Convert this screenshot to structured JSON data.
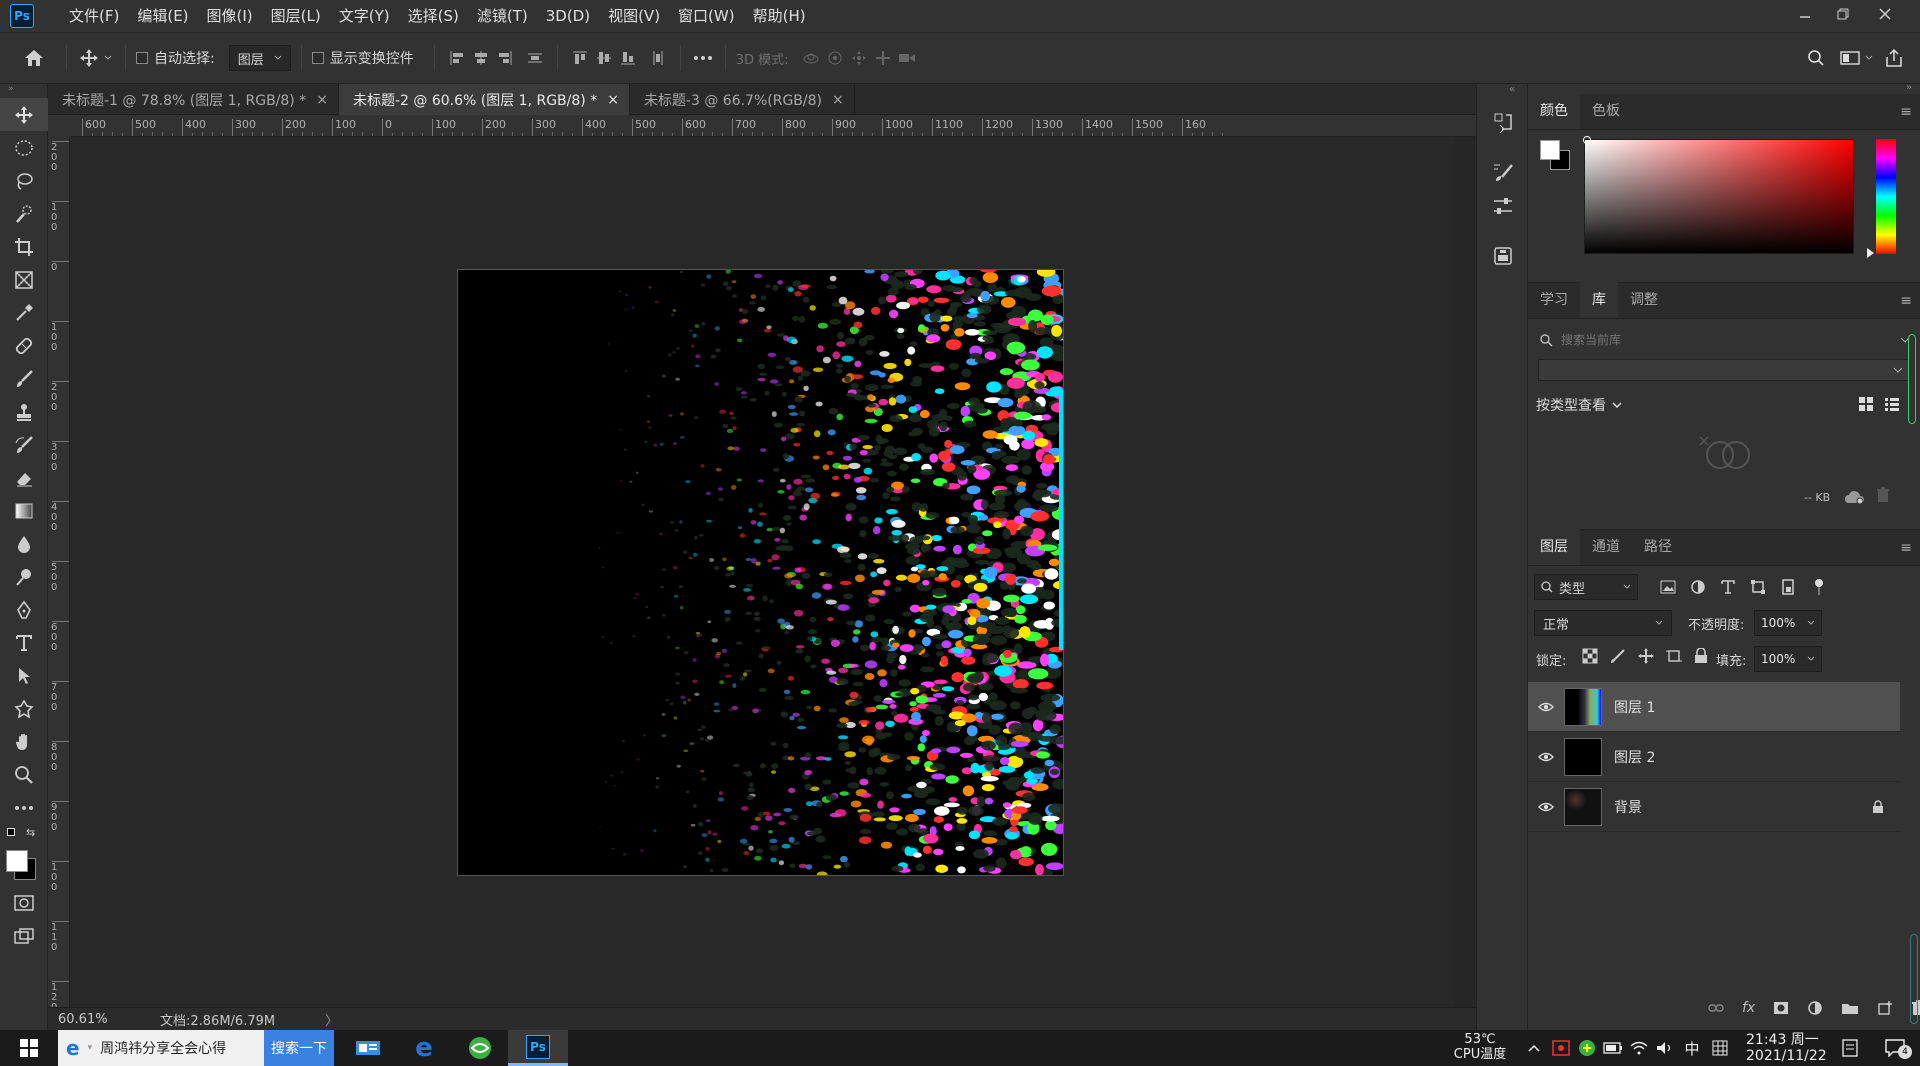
{
  "app": {
    "logo": "Ps"
  },
  "menu": {
    "items": [
      "文件(F)",
      "编辑(E)",
      "图像(I)",
      "图层(L)",
      "文字(Y)",
      "选择(S)",
      "滤镜(T)",
      "3D(D)",
      "视图(V)",
      "窗口(W)",
      "帮助(H)"
    ]
  },
  "options": {
    "auto_select_label": "自动选择:",
    "auto_select_target": "图层",
    "show_transform_label": "显示变换控件",
    "mode3d_label": "3D 模式:"
  },
  "tabs": [
    {
      "label": "未标题-1 @ 78.8% (图层 1, RGB/8) *",
      "close": "×"
    },
    {
      "label": "未标题-2 @ 60.6% (图层 1, RGB/8) *",
      "close": "×"
    },
    {
      "label": "未标题-3 @ 66.7%(RGB/8)",
      "close": "×"
    }
  ],
  "ruler": {
    "h_labels": [
      "600",
      "500",
      "400",
      "300",
      "200",
      "100",
      "0",
      "100",
      "200",
      "300",
      "400",
      "500",
      "600",
      "700",
      "800",
      "900",
      "1000",
      "1100",
      "1200",
      "1300",
      "1400",
      "1500",
      "160"
    ],
    "v_labels": [
      "2\n0\n0",
      "1\n0\n0",
      "0",
      "1\n0\n0",
      "2\n0\n0",
      "3\n0\n0",
      "4\n0\n0",
      "5\n0\n0",
      "6\n0\n0",
      "7\n0\n0",
      "8\n0\n0",
      "9\n0\n0",
      "1\n0\n0",
      "1\n1\n0",
      "1\n2\n0"
    ]
  },
  "status": {
    "zoom": "60.61%",
    "doc_size": "文档:2.86M/6.79M",
    "arrow": "〉"
  },
  "color_panel": {
    "tabs": [
      "颜色",
      "色板"
    ],
    "accent": "#ff0000"
  },
  "library_panel": {
    "tabs": [
      "学习",
      "库",
      "调整"
    ],
    "search_placeholder": "搜索当前库",
    "view_by": "按类型查看",
    "size_label": "-- KB"
  },
  "layers_panel": {
    "tabs": [
      "图层",
      "通道",
      "路径"
    ],
    "filter_kind": "类型",
    "blend_mode": "正常",
    "opacity_label": "不透明度:",
    "opacity_value": "100%",
    "lock_label": "锁定:",
    "fill_label": "填充:",
    "fill_value": "100%",
    "layers": [
      {
        "name": "图层 1",
        "selected": true
      },
      {
        "name": "图层 2",
        "selected": false
      },
      {
        "name": "背景",
        "selected": false,
        "locked": true
      }
    ]
  },
  "taskbar": {
    "browser_label": "周鸿祎分享全会心得",
    "search_button": "搜索一下",
    "cpu_temp": "53℃",
    "cpu_label": "CPU温度",
    "ime": "中",
    "time": "21:43 周一",
    "date": "2021/11/22",
    "notification_count": "4"
  }
}
